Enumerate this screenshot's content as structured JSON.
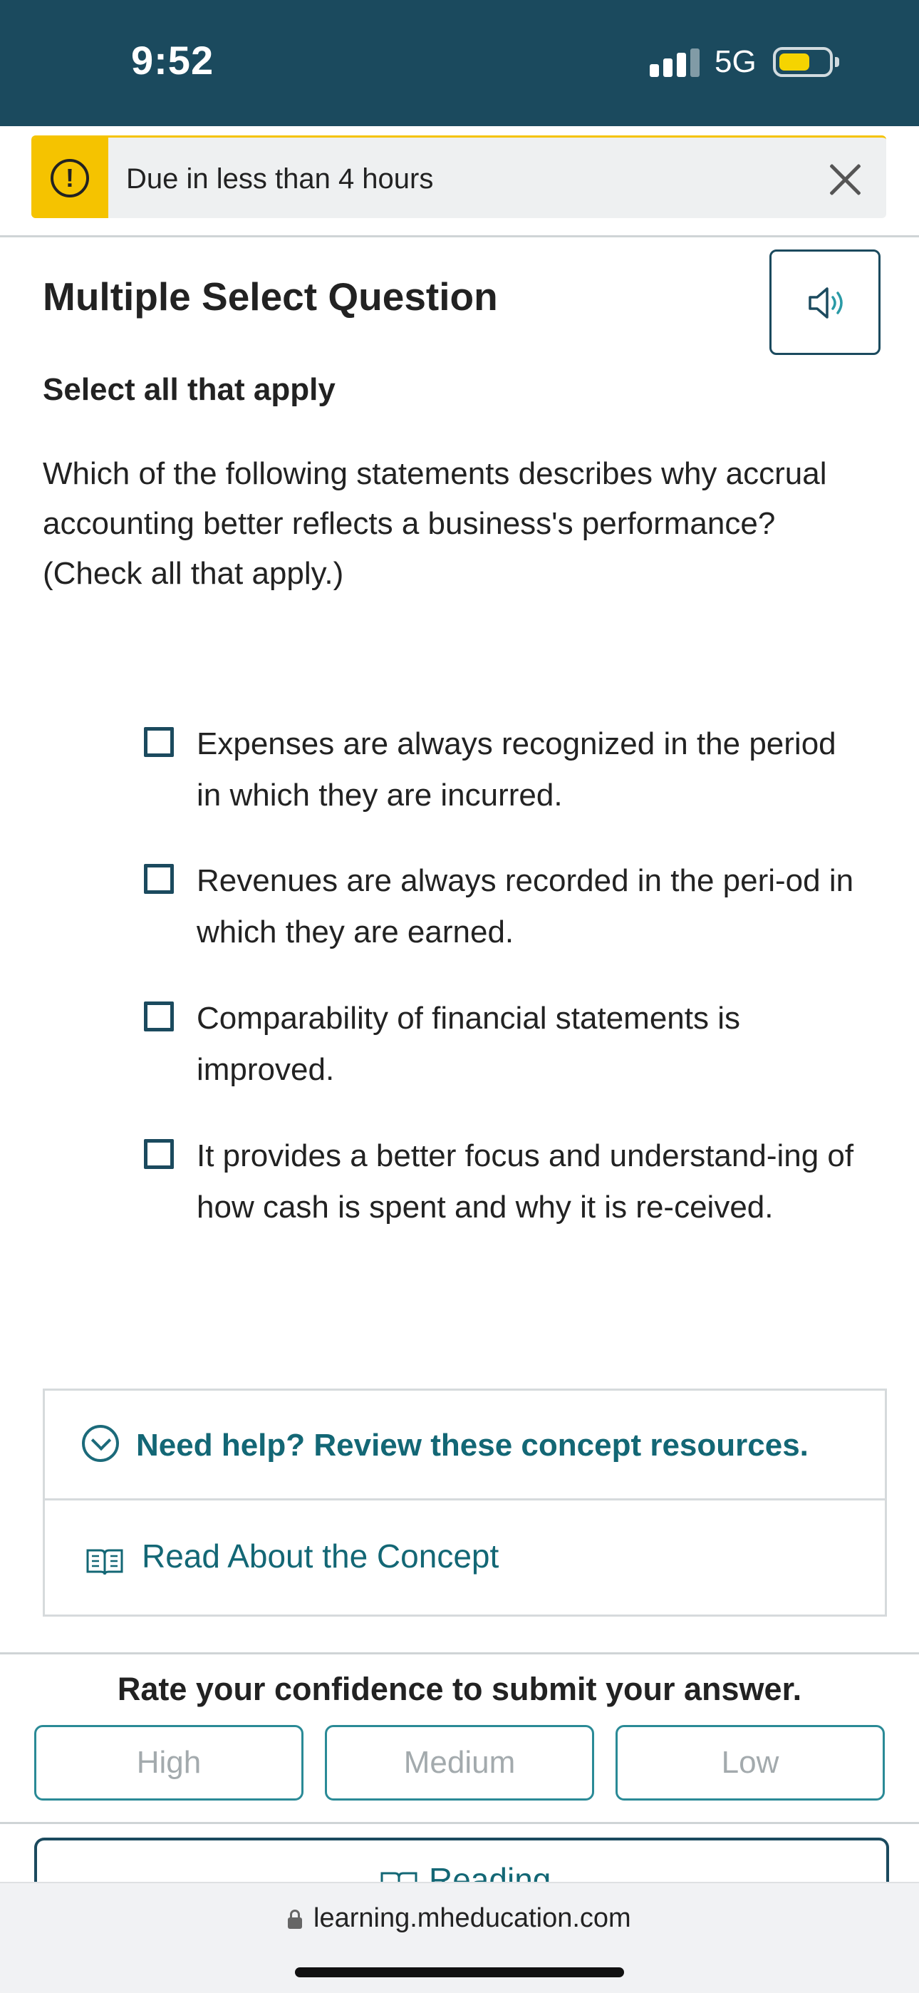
{
  "status_bar": {
    "time": "9:52",
    "network": "5G"
  },
  "banner": {
    "text": "Due in less than 4 hours",
    "warning_icon": "warning-icon",
    "close_icon": "close-icon",
    "accent": "#f5c300"
  },
  "question": {
    "type_title": "Multiple Select Question",
    "instruction": "Select all that apply",
    "prompt": "Which of the following statements describes why accrual accounting better reflects a business's performance? (Check all that apply.)",
    "audio_icon": "speaker-icon",
    "options": [
      {
        "text": "Expenses are always recognized in the period in which they are incurred.",
        "checked": false
      },
      {
        "text": "Revenues are always recorded in the peri-od in which they are earned.",
        "checked": false
      },
      {
        "text": "Comparability of financial statements is improved.",
        "checked": false
      },
      {
        "text": "It provides a better focus and understand-ing of how cash is spent and why it is re-ceived.",
        "checked": false
      }
    ]
  },
  "help": {
    "toggle_text": "Need help? Review these concept resources.",
    "read_link": "Read About the Concept"
  },
  "confidence": {
    "title": "Rate your confidence to submit your answer.",
    "buttons": [
      "High",
      "Medium",
      "Low"
    ]
  },
  "reading_button": "Reading",
  "browser": {
    "url": "learning.mheducation.com"
  },
  "colors": {
    "header": "#1b4a5e",
    "link": "#136775",
    "border_teal": "#2a8a96"
  }
}
